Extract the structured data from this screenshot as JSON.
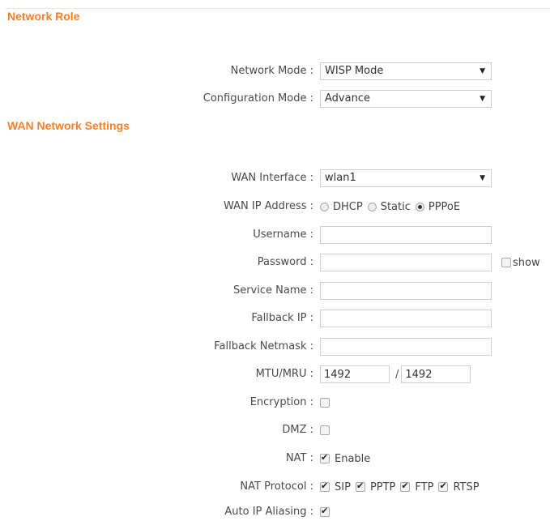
{
  "sections": {
    "network_role": "Network Role",
    "wan_settings": "WAN Network Settings"
  },
  "network_role": {
    "network_mode": {
      "label": "Network Mode :",
      "value": "WISP Mode"
    },
    "configuration_mode": {
      "label": "Configuration Mode :",
      "value": "Advance"
    }
  },
  "wan": {
    "wan_interface": {
      "label": "WAN Interface :",
      "value": "wlan1"
    },
    "wan_ip_address": {
      "label": "WAN IP Address :",
      "options": [
        "DHCP",
        "Static",
        "PPPoE"
      ],
      "selected": "PPPoE"
    },
    "username": {
      "label": "Username :",
      "value": ""
    },
    "password": {
      "label": "Password :",
      "value": "",
      "show_label": "show",
      "show_checked": false
    },
    "service_name": {
      "label": "Service Name :",
      "value": ""
    },
    "fallback_ip": {
      "label": "Fallback IP :",
      "value": ""
    },
    "fallback_netmask": {
      "label": "Fallback Netmask :",
      "value": ""
    },
    "mtu_mru": {
      "label": "MTU/MRU :",
      "mtu": "1492",
      "separator": "/",
      "mru": "1492"
    },
    "encryption": {
      "label": "Encryption :",
      "checked": false
    },
    "dmz": {
      "label": "DMZ :",
      "checked": false
    },
    "nat": {
      "label": "NAT :",
      "checked": true,
      "option_label": "Enable"
    },
    "nat_protocol": {
      "label": "NAT Protocol :",
      "options": [
        {
          "label": "SIP",
          "checked": true
        },
        {
          "label": "PPTP",
          "checked": true
        },
        {
          "label": "FTP",
          "checked": true
        },
        {
          "label": "RTSP",
          "checked": true
        }
      ]
    },
    "auto_ip_aliasing": {
      "label": "Auto IP Aliasing :",
      "checked": true
    }
  },
  "icons": {
    "dropdown_arrow": "▼"
  },
  "colors": {
    "section_title": "#f57f2a"
  }
}
